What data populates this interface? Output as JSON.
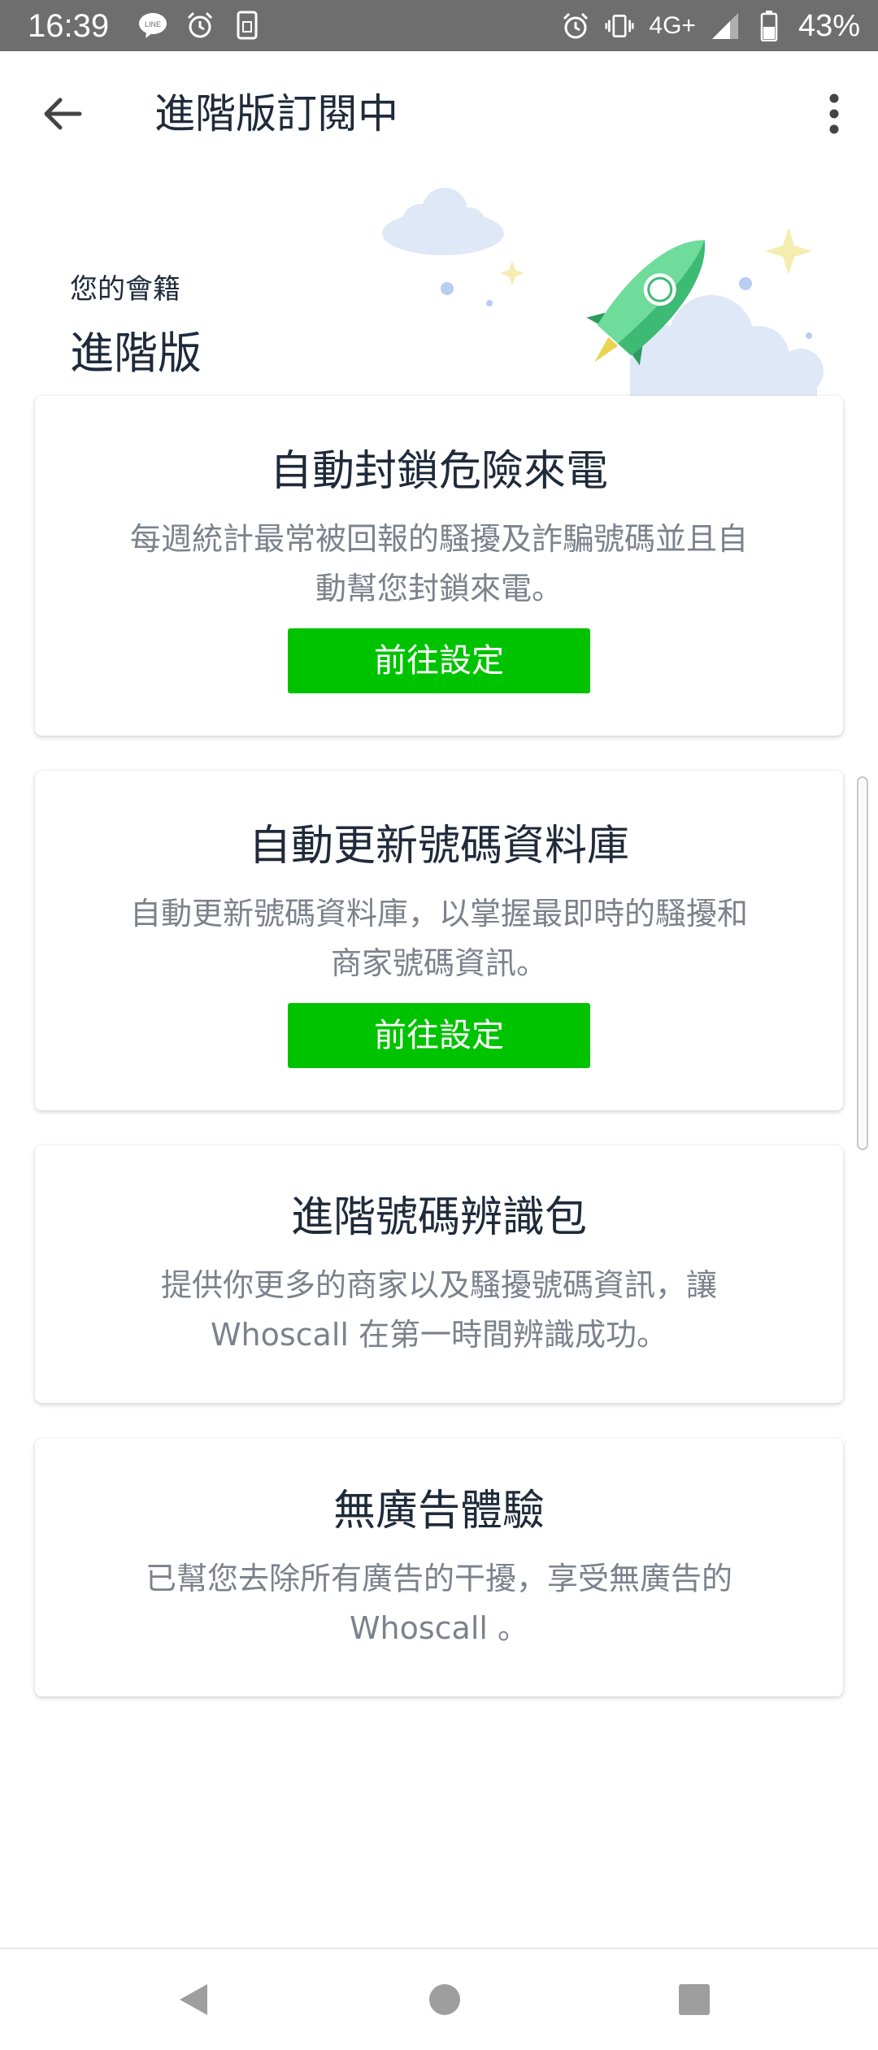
{
  "status_bar": {
    "time": "16:39",
    "network": "4G+",
    "battery": "43%",
    "left_icons": [
      "line-icon",
      "alarm-icon",
      "sim-icon"
    ],
    "right_icons": [
      "alarm-icon",
      "vibrate-icon",
      "signal-icon",
      "battery-icon"
    ]
  },
  "app_bar": {
    "title": "進階版訂閱中",
    "back_icon": "arrow-left-icon",
    "more_icon": "more-vert-icon"
  },
  "membership": {
    "label": "您的會籍",
    "plan": "進階版"
  },
  "cards": [
    {
      "title": "自動封鎖危險來電",
      "desc_line1": "每週統計最常被回報的騷擾及詐騙號碼並且自",
      "desc_line2": "動幫您封鎖來電。",
      "button": "前往設定"
    },
    {
      "title": "自動更新號碼資料庫",
      "desc_line1": "自動更新號碼資料庫，以掌握最即時的騷擾和",
      "desc_line2": "商家號碼資訊。",
      "button": "前往設定"
    },
    {
      "title": "進階號碼辨識包",
      "desc_line1": "提供你更多的商家以及騷擾號碼資訊，讓",
      "desc_line2": "Whoscall 在第一時間辨識成功。"
    },
    {
      "title": "無廣告體驗",
      "desc_line1": "已幫您去除所有廣告的干擾，享受無廣告的",
      "desc_line2": "Whoscall 。"
    }
  ],
  "colors": {
    "accent_green": "#00c300",
    "title_text": "#1f2a3a",
    "desc_text": "#7b828c",
    "status_bar": "#6e6e6e"
  },
  "nav_bar": {
    "icons": [
      "back-triangle-icon",
      "home-circle-icon",
      "recents-square-icon"
    ]
  }
}
